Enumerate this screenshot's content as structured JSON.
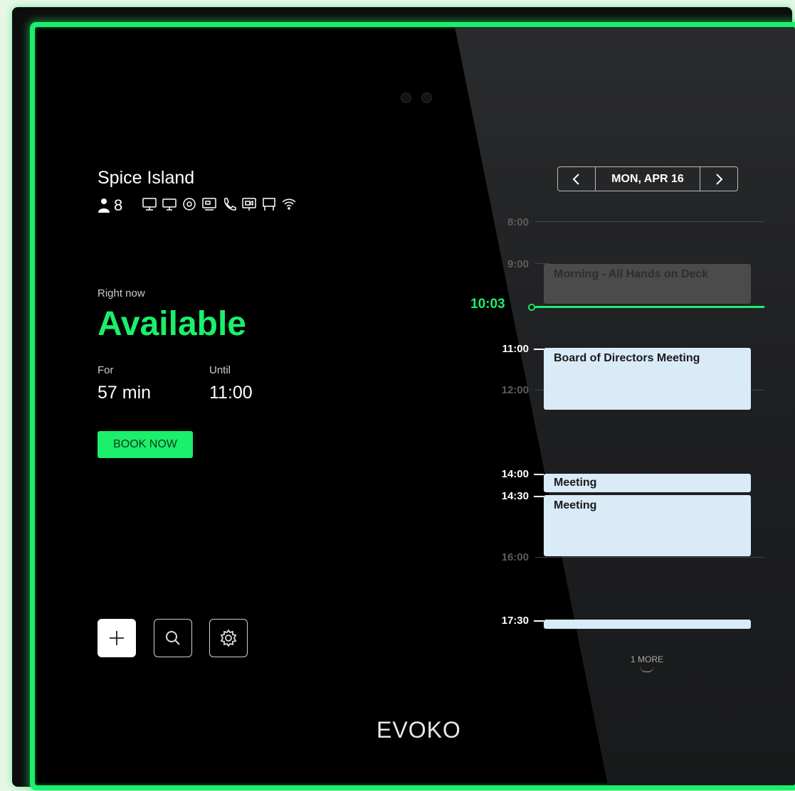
{
  "room": {
    "name": "Spice Island",
    "capacity": "8"
  },
  "amenities": [
    "monitor-icon",
    "display-icon",
    "webcam-icon",
    "video-conference-icon",
    "phone-icon",
    "projector-icon",
    "whiteboard-icon",
    "wifi-icon"
  ],
  "status": {
    "right_now_label": "Right now",
    "state": "Available",
    "for_label": "For",
    "for_value": "57 min",
    "until_label": "Until",
    "until_value": "11:00",
    "book_button": "BOOK NOW"
  },
  "schedule": {
    "date": "MON, APR 16",
    "current_time": "10:03",
    "time_labels": [
      "8:00",
      "9:00",
      "11:00",
      "12:00",
      "14:00",
      "14:30",
      "16:00",
      "17:30"
    ],
    "events": [
      {
        "title": "Morning - All Hands on Deck",
        "start": "9:00",
        "state": "past"
      },
      {
        "title": "Board of Directors Meeting",
        "start": "11:00",
        "end": "12:00"
      },
      {
        "title": "Meeting",
        "start": "14:00",
        "end": "14:30"
      },
      {
        "title": "Meeting",
        "start": "14:30",
        "end": "16:00"
      },
      {
        "title": "",
        "start": "17:30"
      }
    ],
    "more_label": "1 MORE"
  },
  "actions": [
    "add-icon",
    "search-icon",
    "settings-icon"
  ],
  "brand": {
    "logo": "EVOKO",
    "accent_color": "#1bef6b"
  }
}
